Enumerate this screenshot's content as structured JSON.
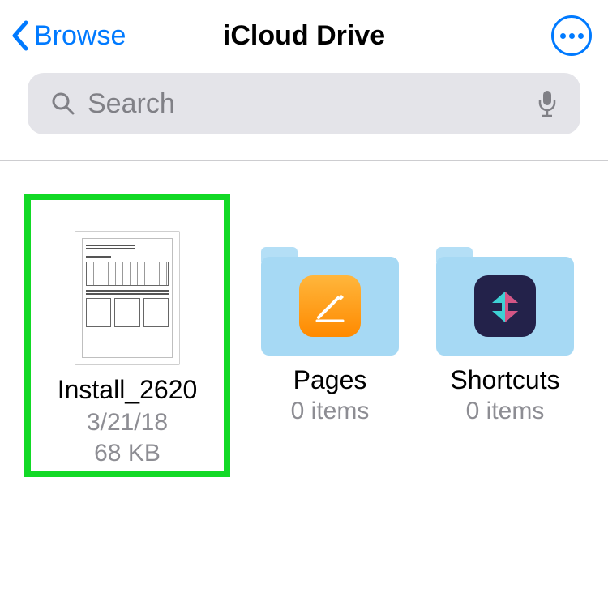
{
  "nav": {
    "back_label": "Browse",
    "title": "iCloud Drive"
  },
  "search": {
    "placeholder": "Search"
  },
  "items": [
    {
      "name": "Install_2620",
      "meta1": "3/21/18",
      "meta2": "68 KB"
    },
    {
      "name": "Pages",
      "meta1": "0 items"
    },
    {
      "name": "Shortcuts",
      "meta1": "0 items"
    }
  ]
}
